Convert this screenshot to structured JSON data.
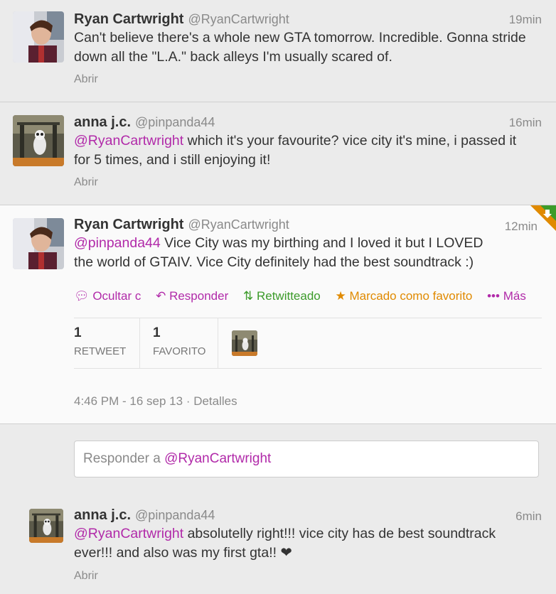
{
  "tweets": [
    {
      "name": "Ryan Cartwright",
      "handle": "@RyanCartwright",
      "time": "19min",
      "text": "Can't believe there's a whole new GTA tomorrow. Incredible. Gonna stride down all the \"L.A.\" back alleys I'm usually scared of.",
      "expand": "Abrir"
    },
    {
      "name": "anna j.c.",
      "handle": "@pinpanda44",
      "time": "16min",
      "mention": "@RyanCartwright",
      "text": " which it's your favourite? vice city it's mine, i passed it for 5 times, and i still enjoying it!",
      "expand": "Abrir"
    },
    {
      "name": "Ryan Cartwright",
      "handle": "@RyanCartwright",
      "time": "12min",
      "mention": "@pinpanda44",
      "text": " Vice City was my birthing and I loved it but I LOVED the world of GTAIV. Vice City definitely had the best soundtrack :)",
      "actions": {
        "hide": "Ocultar c",
        "reply": "Responder",
        "retweeted": "Retwitteado",
        "favorited": "Marcado como favorito",
        "more": "Más"
      },
      "stats": {
        "retweets": "1",
        "retweets_label": "RETWEET",
        "favorites": "1",
        "favorites_label": "FAVORITO"
      },
      "date": "4:46 PM - 16 sep 13",
      "details": "Detalles"
    },
    {
      "name": "anna j.c.",
      "handle": "@pinpanda44",
      "time": "6min",
      "mention": "@RyanCartwright",
      "text": " absolutelly right!!! vice city has de best soundtrack ever!!! and also was my first gta!! ❤",
      "expand": "Abrir"
    }
  ],
  "reply": {
    "prefix": "Responder a ",
    "mention": "@RyanCartwright"
  },
  "colors": {
    "mention": "#b12aa9",
    "retweet": "#3c9b2a",
    "favorite": "#e08a00"
  }
}
